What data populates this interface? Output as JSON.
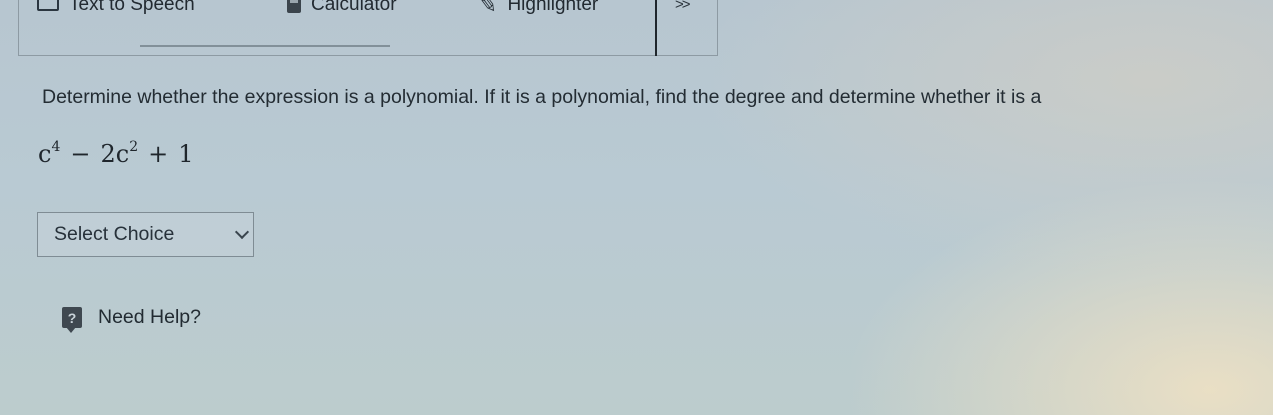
{
  "toolbar": {
    "tts_label": "Text to Speech",
    "calculator_label": "Calculator",
    "highlighter_label": "Highlighter",
    "more_label": ">>"
  },
  "question": {
    "prompt": "Determine whether the expression is a polynomial. If it is a polynomial, find the degree and determine whether it is a",
    "expression": {
      "term1_base": "c",
      "term1_exp": "4",
      "op1": "−",
      "term2_coef_base": "2c",
      "term2_exp": "2",
      "op2": "+",
      "term3": "1"
    }
  },
  "select": {
    "value": "Select Choice"
  },
  "help": {
    "icon_glyph": "?",
    "label": "Need Help?"
  },
  "icons": {
    "tts": "speaker-screen-icon",
    "calculator": "calculator-icon",
    "highlighter": "highlighter-pen-icon",
    "dropdown": "chevron-down-icon",
    "help": "question-bubble-icon"
  }
}
